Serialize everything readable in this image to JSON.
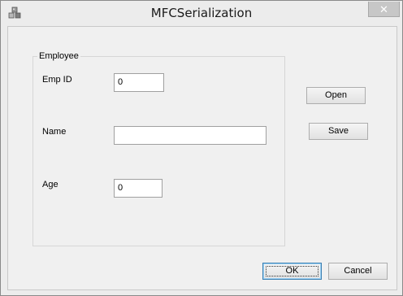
{
  "window": {
    "title": "MFCSerialization",
    "close_glyph": "✕"
  },
  "group": {
    "title": "Employee"
  },
  "fields": {
    "emp_id": {
      "label": "Emp ID",
      "value": "0"
    },
    "name": {
      "label": "Name",
      "value": ""
    },
    "age": {
      "label": "Age",
      "value": "0"
    }
  },
  "buttons": {
    "open": "Open",
    "save": "Save",
    "ok": "OK",
    "cancel": "Cancel"
  },
  "colors": {
    "dialog_background": "#f0f0f0",
    "default_button_border": "#3c7fb1"
  },
  "icons": {
    "app": "mfc-app-icon",
    "close": "close-icon"
  }
}
